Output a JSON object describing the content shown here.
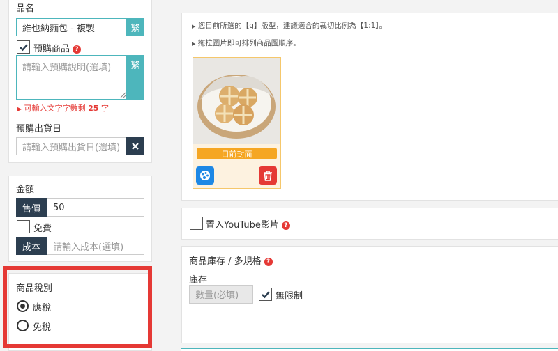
{
  "product": {
    "name_label": "品名",
    "name_value": "維也納麵包 - 複製",
    "trad_label": "繁",
    "preorder_label": "預購商品",
    "preorder_desc_placeholder": "請輸入預購說明(選填)",
    "char_remaining_prefix": "可輸入文字字數剩",
    "char_remaining_count": "25",
    "char_remaining_suffix": "字",
    "ship_date_label": "預購出貨日",
    "ship_date_placeholder": "請輸入預購出貨日(選填)"
  },
  "amount": {
    "title": "金額",
    "price_label": "售價",
    "price_value": "50",
    "free_label": "免費",
    "cost_label": "成本",
    "cost_placeholder": "請輸入成本(選填)"
  },
  "tax": {
    "title": "商品稅別",
    "options": [
      {
        "label": "應稅",
        "selected": true
      },
      {
        "label": "免稅",
        "selected": false
      }
    ],
    "highlight_color": "#e53935"
  },
  "images": {
    "hint1": "您目前所選的【g】版型，建議適合的裁切比例為【1:1】。",
    "hint2": "拖拉圖片即可排列商品圖順序。",
    "cover_label": "目前封面"
  },
  "youtube": {
    "label": "置入YouTube影片"
  },
  "inventory": {
    "title": "商品庫存 / 多規格",
    "stock_label": "庫存",
    "qty_placeholder": "數量(必填)",
    "unlimited_label": "無限制"
  },
  "colors": {
    "teal": "#4db6bc",
    "dark": "#2c3e50",
    "orange": "#f5a623",
    "red": "#e53935",
    "blue": "#1e88e5"
  }
}
